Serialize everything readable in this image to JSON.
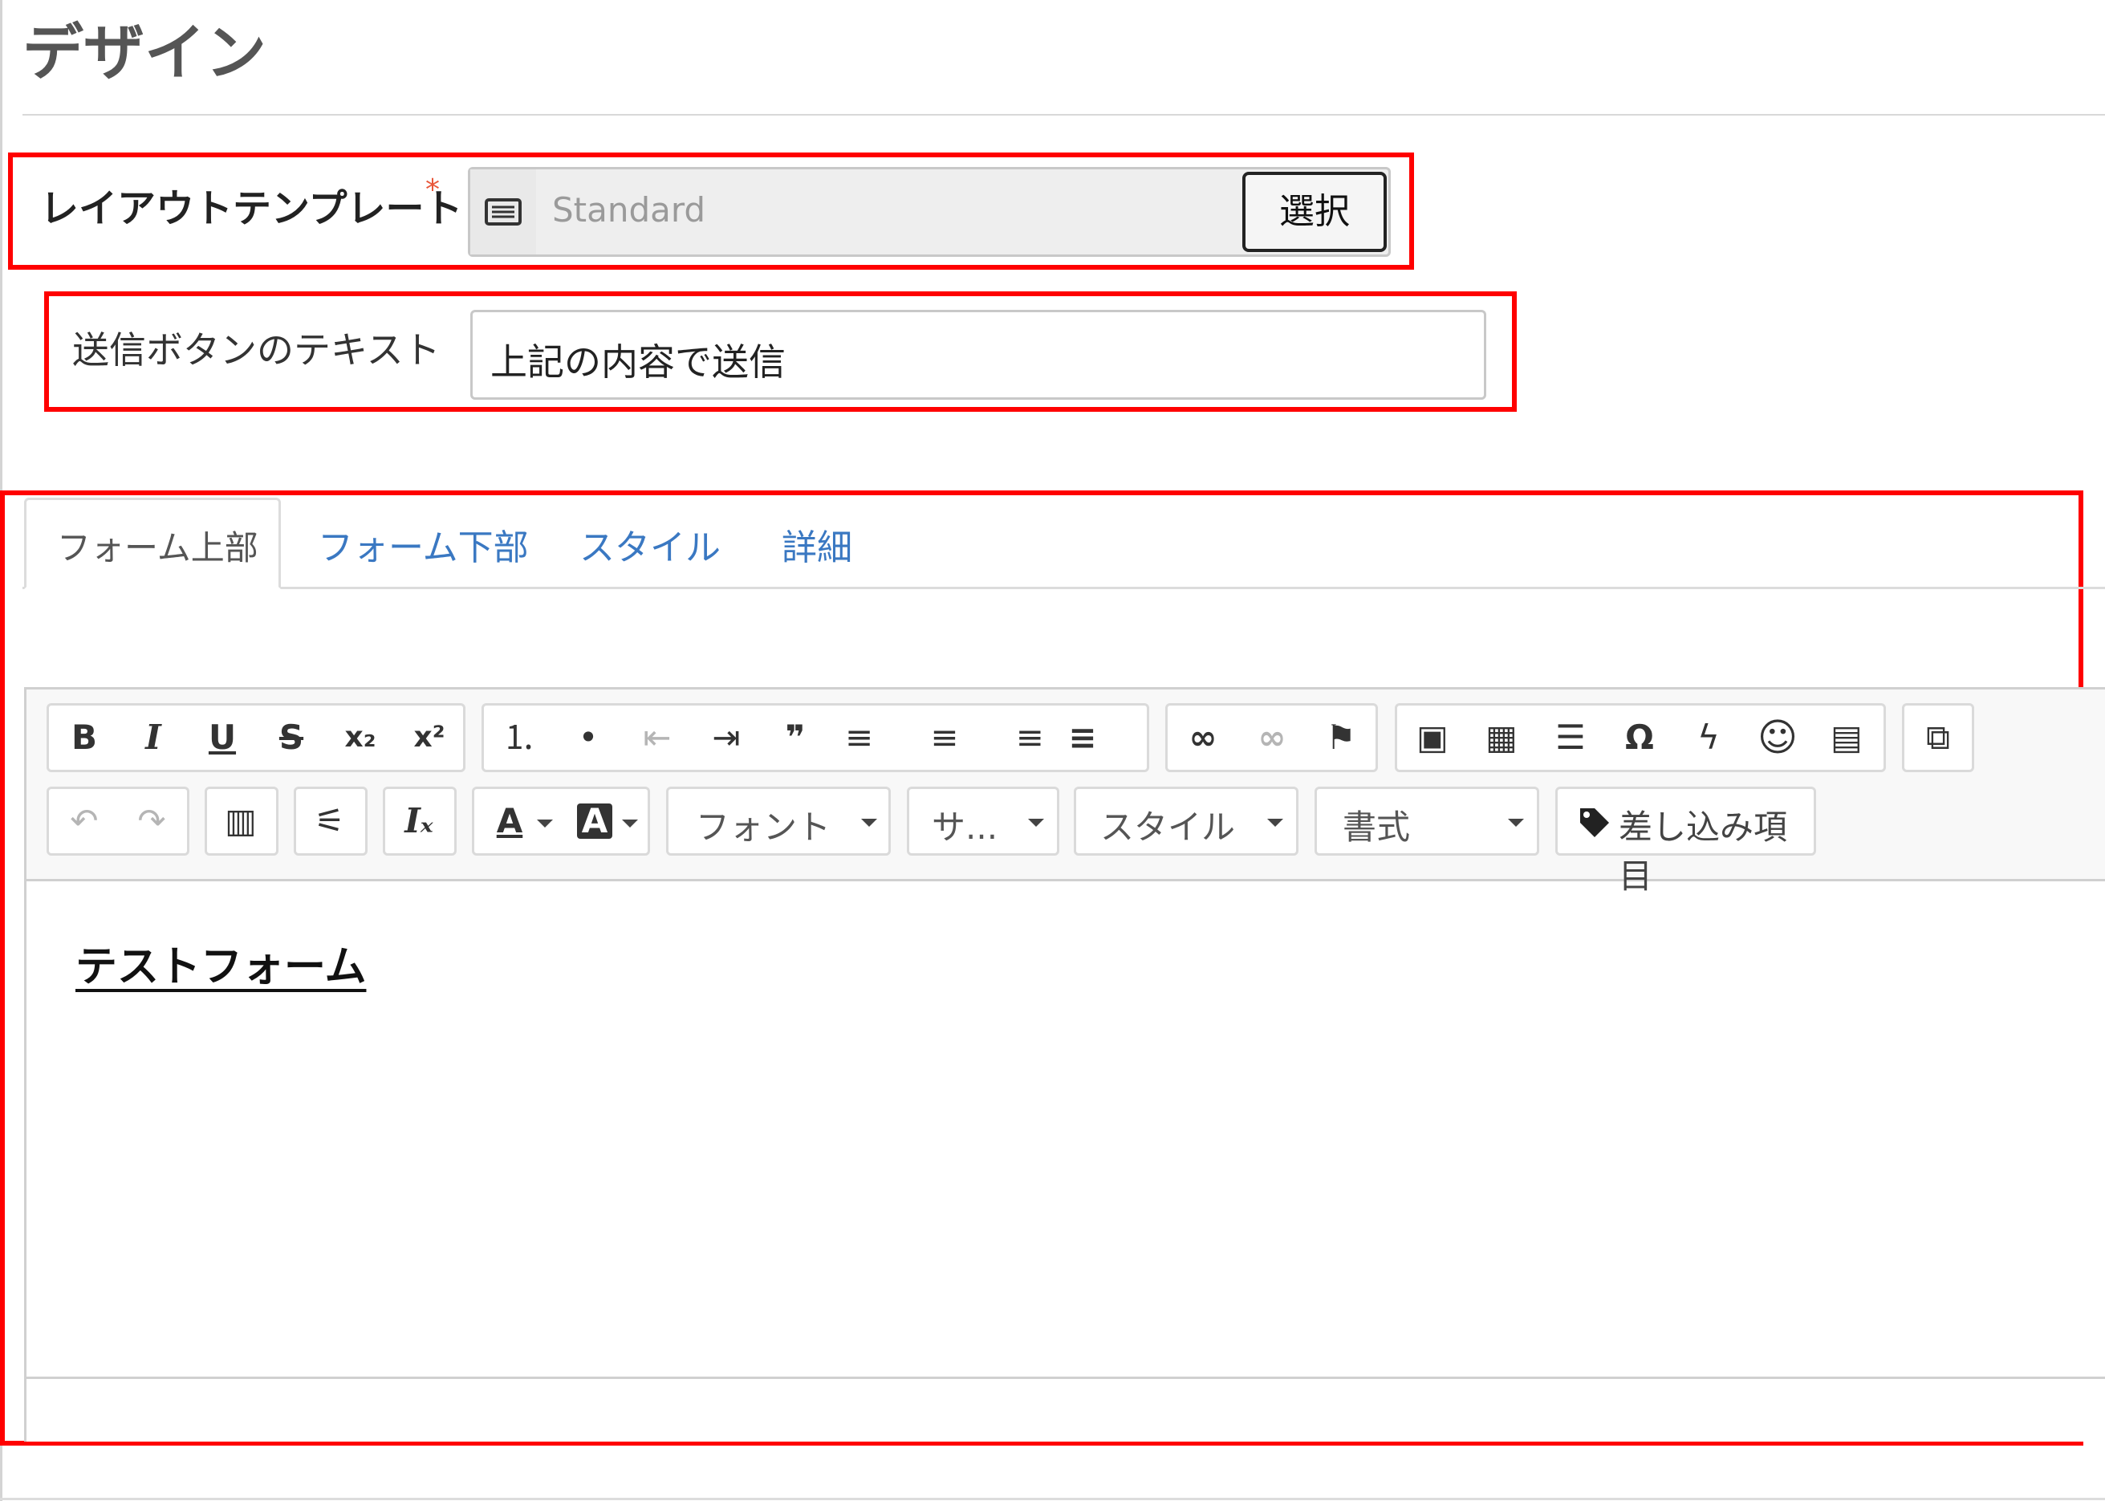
{
  "section": {
    "title": "デザイン"
  },
  "layout_template": {
    "label": "レイアウトテンプレート",
    "required_mark": "*",
    "value": "Standard",
    "select_button": "選択",
    "icon": "list-icon"
  },
  "submit_text": {
    "label": "送信ボタンのテキスト",
    "value": "上記の内容で送信"
  },
  "tabs": [
    {
      "label": "フォーム上部",
      "active": true
    },
    {
      "label": "フォーム下部",
      "active": false
    },
    {
      "label": "スタイル",
      "active": false
    },
    {
      "label": "詳細",
      "active": false
    }
  ],
  "toolbar": {
    "row1": {
      "bold": "B",
      "italic": "I",
      "underline": "U",
      "strike": "S",
      "subscript": "x₂",
      "superscript": "x²",
      "numbered_list": "⒈",
      "bullet_list": "•",
      "outdent": "⇤",
      "indent": "⇥",
      "blockquote": "❞",
      "align_left": "≡",
      "align_center": "≡",
      "align_right": "≡",
      "justify": "≡",
      "link": "∞",
      "unlink": "∞",
      "anchor": "⚑",
      "image": "▣",
      "table": "▦",
      "horizontal_rule": "☰",
      "special_char": "Ω",
      "flash": "ϟ",
      "smiley": "☺",
      "template": "▤",
      "source": "⧉"
    },
    "row2": {
      "undo": "↶",
      "redo": "↷",
      "paste": "▥",
      "settings": "⚟",
      "clear_format": "Iₓ",
      "text_color": "A",
      "bg_color": "A",
      "font_combo": "フォント",
      "size_combo": "サ...",
      "style_combo": "スタイル",
      "format_combo": "書式",
      "merge_field": "差し込み項目"
    }
  },
  "editor": {
    "content_heading": "テストフォーム"
  },
  "colors": {
    "highlight": "#ff0000",
    "tab_link": "#3a78c2"
  }
}
